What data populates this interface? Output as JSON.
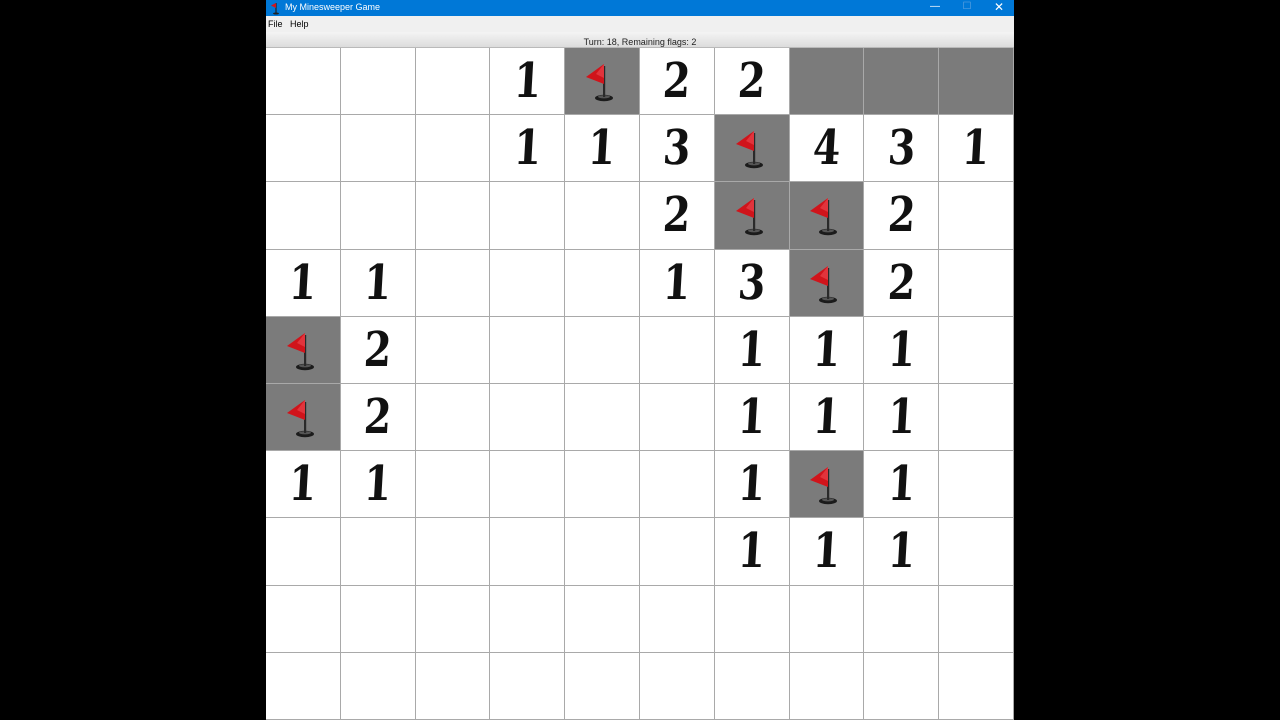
{
  "window": {
    "title": "My Minesweeper Game",
    "icon": "app-flag-icon",
    "controls": {
      "minimize": "—",
      "maximize": "☐",
      "close": "✕"
    }
  },
  "menu": {
    "file": "File",
    "help": "Help"
  },
  "status": {
    "text": "Turn: 18, Remaining flags: 2"
  },
  "colors": {
    "titlebar": "#0078d7",
    "covered_cell": "#7b7b7b",
    "flag_red": "#d0141b",
    "grid_line": "#a9a9a9"
  },
  "board": {
    "rows": 10,
    "cols": 10,
    "cells": [
      [
        "",
        "",
        "",
        "1",
        "F",
        "2",
        "2",
        "#",
        "#",
        "#"
      ],
      [
        "",
        "",
        "",
        "1",
        "1",
        "3",
        "F",
        "4",
        "3",
        "1"
      ],
      [
        "",
        "",
        "",
        "",
        "",
        "2",
        "F",
        "F",
        "2",
        ""
      ],
      [
        "1",
        "1",
        "",
        "",
        "",
        "1",
        "3",
        "F",
        "2",
        ""
      ],
      [
        "F",
        "2",
        "",
        "",
        "",
        "",
        "1",
        "1",
        "1",
        ""
      ],
      [
        "F",
        "2",
        "",
        "",
        "",
        "",
        "1",
        "1",
        "1",
        ""
      ],
      [
        "1",
        "1",
        "",
        "",
        "",
        "",
        "1",
        "F",
        "1",
        ""
      ],
      [
        "",
        "",
        "",
        "",
        "",
        "",
        "1",
        "1",
        "1",
        ""
      ],
      [
        "",
        "",
        "",
        "",
        "",
        "",
        "",
        "",
        "",
        ""
      ],
      [
        "",
        "",
        "",
        "",
        "",
        "",
        "",
        "",
        "",
        ""
      ]
    ]
  }
}
